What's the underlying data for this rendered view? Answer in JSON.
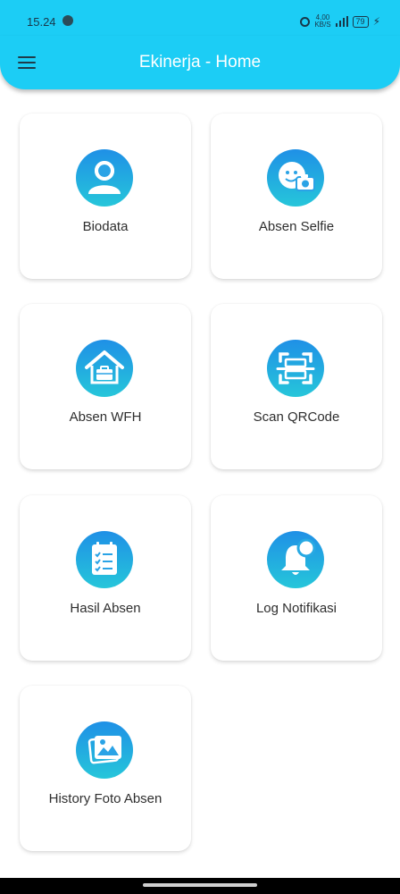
{
  "status_bar": {
    "time": "15.24",
    "net_speed_value": "4,00",
    "net_speed_unit": "KB/S",
    "battery": "79"
  },
  "app_bar": {
    "title": "Ekinerja - Home",
    "menu_icon": "hamburger-menu-icon"
  },
  "menu": {
    "items": [
      {
        "label": "Biodata",
        "icon": "person-icon"
      },
      {
        "label": "Absen Selfie",
        "icon": "selfie-camera-icon"
      },
      {
        "label": "Absen WFH",
        "icon": "home-work-icon"
      },
      {
        "label": "Scan QRCode",
        "icon": "qr-scan-icon"
      },
      {
        "label": "Hasil Absen",
        "icon": "checklist-icon"
      },
      {
        "label": "Log Notifikasi",
        "icon": "notification-bell-icon"
      },
      {
        "label": "History Foto Absen",
        "icon": "photo-gallery-icon"
      }
    ]
  },
  "colors": {
    "primary": "#1ccdf5",
    "icon_gradient_top": "#1f90e6",
    "icon_gradient_bottom": "#26c6da"
  }
}
